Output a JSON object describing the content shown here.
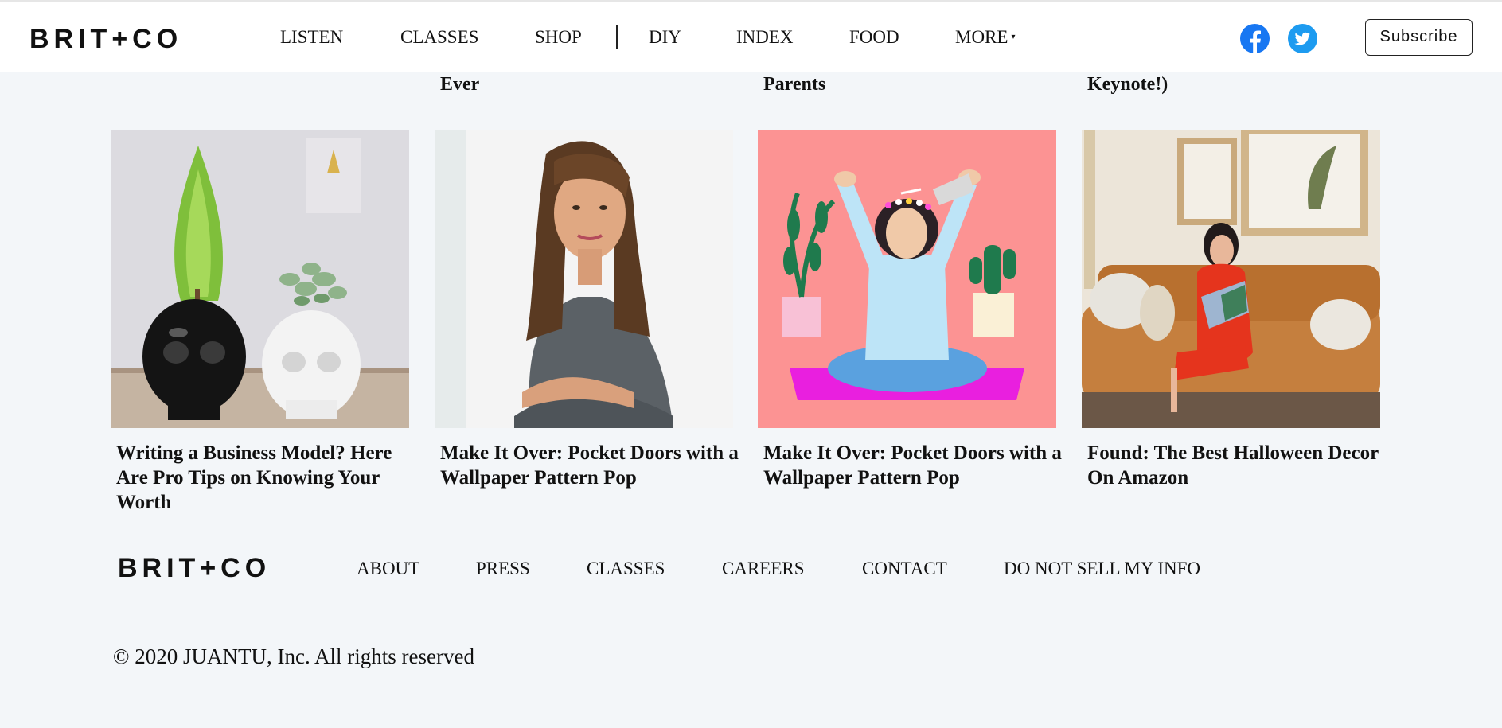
{
  "brand": {
    "logo": "BRIT+CO"
  },
  "header": {
    "nav": [
      "LISTEN",
      "CLASSES",
      "SHOP",
      "DIY",
      "INDEX",
      "FOOD",
      "MORE"
    ],
    "more_caret": "▾",
    "subscribe_label": "Subscribe"
  },
  "cutoff_titles": [
    "Ever",
    "Parents",
    "Keynote!)"
  ],
  "cards": [
    {
      "title": "Writing a Business Model? Here Are Pro Tips on Knowing Your Worth"
    },
    {
      "title": "Make It Over: Pocket Doors with a Wallpaper Pattern Pop"
    },
    {
      "title": "Make It Over: Pocket Doors with a Wallpaper Pattern Pop"
    },
    {
      "title": "Found: The Best Halloween Decor On Amazon"
    }
  ],
  "footer": {
    "links": [
      "ABOUT",
      "PRESS",
      "CLASSES",
      "CAREERS",
      "CONTACT",
      "DO NOT SELL MY INFO"
    ],
    "copyright": "© 2020 JUANTU, Inc. All rights reserved"
  },
  "colors": {
    "facebook": "#1877f2",
    "twitter": "#1d9bf0",
    "page_bg": "#f3f6f9"
  },
  "icons": [
    "facebook-icon",
    "twitter-icon"
  ]
}
